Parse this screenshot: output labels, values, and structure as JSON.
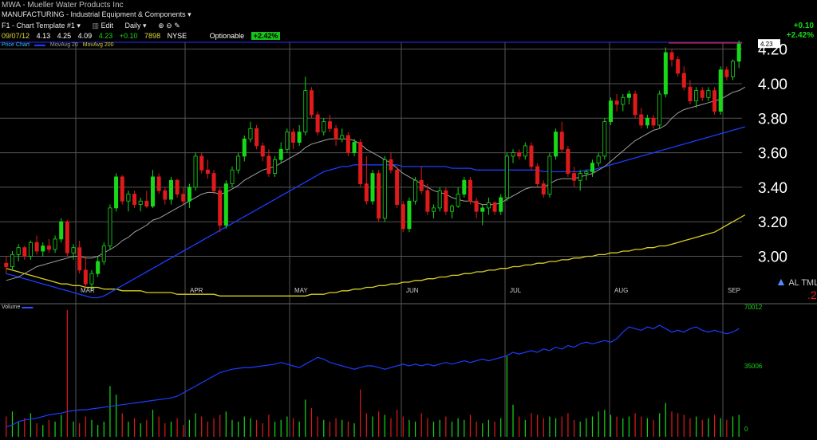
{
  "header": {
    "title": "MWA - Mueller Water Products Inc",
    "sector": "MANUFACTURING - Industrial Equipment & Components",
    "template": "F1 - Chart Template #1",
    "edit_label": "Edit",
    "period_label": "Daily",
    "date": "09/07/12",
    "open": "4.13",
    "high": "4.25",
    "low": "4.09",
    "close": "4.23",
    "change": "+0.10",
    "volume": "7898",
    "exchange": "NYSE",
    "optionable": "Optionable",
    "pct_badge": "+2.42%",
    "right_change": "+0.10",
    "right_pct": "+2.42%"
  },
  "legend": {
    "price": "Price Chart",
    "ma20": "MovAvg 20",
    "ma200": "MovAvg 200"
  },
  "tools": {
    "label": "AL TML",
    "extra": ".2"
  },
  "volume_label": "Volume",
  "colors": {
    "up": "#17d917",
    "down": "#e01a1a",
    "ma20": "#a0a0a0",
    "ma50": "#1a3dff",
    "ma200": "#d8d020",
    "grid": "#555555",
    "volume_ma": "#1a3dff"
  },
  "chart_data": {
    "type": "candlestick",
    "price_axis": {
      "ticks": [
        3.0,
        3.2,
        3.4,
        3.6,
        3.8,
        4.0,
        4.2
      ],
      "labels": [
        "3.00",
        "3.20",
        "3.40",
        "3.60",
        "3.80",
        "4.00",
        "4.20"
      ],
      "ylim": [
        2.73,
        4.24
      ]
    },
    "x_labels": [
      "MAR",
      "APR",
      "MAY",
      "JUN",
      "JUL",
      "AUG",
      "SEP"
    ],
    "last_price_label": "4.23",
    "candles": [
      [
        2.96,
        3.0,
        2.9,
        2.94
      ],
      [
        2.94,
        3.03,
        2.92,
        3.01
      ],
      [
        3.01,
        3.07,
        2.97,
        3.05
      ],
      [
        3.05,
        3.06,
        2.98,
        3.0
      ],
      [
        3.0,
        3.09,
        2.98,
        3.08
      ],
      [
        3.08,
        3.12,
        3.01,
        3.03
      ],
      [
        3.03,
        3.08,
        3.0,
        3.06
      ],
      [
        3.06,
        3.1,
        3.02,
        3.04
      ],
      [
        3.04,
        3.12,
        3.02,
        3.1
      ],
      [
        3.1,
        3.22,
        3.08,
        3.2
      ],
      [
        3.2,
        3.21,
        3.0,
        3.02
      ],
      [
        3.02,
        3.07,
        2.98,
        3.05
      ],
      [
        3.05,
        3.09,
        2.9,
        2.92
      ],
      [
        2.92,
        3.0,
        2.82,
        2.84
      ],
      [
        2.84,
        2.92,
        2.8,
        2.9
      ],
      [
        2.9,
        3.0,
        2.88,
        2.97
      ],
      [
        2.97,
        3.08,
        2.95,
        3.06
      ],
      [
        3.06,
        3.3,
        3.04,
        3.28
      ],
      [
        3.28,
        3.48,
        3.26,
        3.46
      ],
      [
        3.46,
        3.47,
        3.3,
        3.32
      ],
      [
        3.32,
        3.38,
        3.26,
        3.36
      ],
      [
        3.36,
        3.38,
        3.28,
        3.3
      ],
      [
        3.3,
        3.34,
        3.26,
        3.32
      ],
      [
        3.32,
        3.38,
        3.28,
        3.29
      ],
      [
        3.29,
        3.5,
        3.28,
        3.46
      ],
      [
        3.46,
        3.48,
        3.36,
        3.38
      ],
      [
        3.38,
        3.4,
        3.3,
        3.33
      ],
      [
        3.33,
        3.46,
        3.3,
        3.44
      ],
      [
        3.44,
        3.45,
        3.34,
        3.36
      ],
      [
        3.36,
        3.4,
        3.3,
        3.32
      ],
      [
        3.32,
        3.42,
        3.28,
        3.4
      ],
      [
        3.4,
        3.6,
        3.38,
        3.58
      ],
      [
        3.58,
        3.6,
        3.48,
        3.5
      ],
      [
        3.5,
        3.56,
        3.45,
        3.48
      ],
      [
        3.48,
        3.5,
        3.36,
        3.38
      ],
      [
        3.38,
        3.4,
        3.14,
        3.18
      ],
      [
        3.18,
        3.44,
        3.16,
        3.42
      ],
      [
        3.42,
        3.52,
        3.4,
        3.5
      ],
      [
        3.5,
        3.6,
        3.48,
        3.58
      ],
      [
        3.58,
        3.7,
        3.55,
        3.68
      ],
      [
        3.68,
        3.78,
        3.66,
        3.74
      ],
      [
        3.74,
        3.76,
        3.62,
        3.64
      ],
      [
        3.64,
        3.66,
        3.55,
        3.58
      ],
      [
        3.58,
        3.62,
        3.46,
        3.48
      ],
      [
        3.48,
        3.58,
        3.46,
        3.56
      ],
      [
        3.56,
        3.66,
        3.54,
        3.62
      ],
      [
        3.62,
        3.74,
        3.6,
        3.72
      ],
      [
        3.72,
        3.74,
        3.62,
        3.66
      ],
      [
        3.66,
        3.76,
        3.64,
        3.72
      ],
      [
        3.72,
        4.04,
        3.7,
        3.96
      ],
      [
        3.96,
        3.98,
        3.8,
        3.82
      ],
      [
        3.82,
        3.84,
        3.7,
        3.72
      ],
      [
        3.72,
        3.8,
        3.7,
        3.78
      ],
      [
        3.78,
        3.82,
        3.72,
        3.74
      ],
      [
        3.74,
        3.76,
        3.64,
        3.68
      ],
      [
        3.68,
        3.74,
        3.66,
        3.7
      ],
      [
        3.7,
        3.72,
        3.58,
        3.6
      ],
      [
        3.6,
        3.68,
        3.58,
        3.66
      ],
      [
        3.66,
        3.68,
        3.4,
        3.42
      ],
      [
        3.42,
        3.58,
        3.3,
        3.32
      ],
      [
        3.32,
        3.5,
        3.3,
        3.48
      ],
      [
        3.48,
        3.5,
        3.2,
        3.22
      ],
      [
        3.22,
        3.58,
        3.2,
        3.56
      ],
      [
        3.56,
        3.6,
        3.48,
        3.5
      ],
      [
        3.5,
        3.52,
        3.28,
        3.3
      ],
      [
        3.3,
        3.32,
        3.14,
        3.16
      ],
      [
        3.16,
        3.34,
        3.14,
        3.32
      ],
      [
        3.32,
        3.46,
        3.3,
        3.44
      ],
      [
        3.44,
        3.52,
        3.36,
        3.38
      ],
      [
        3.38,
        3.42,
        3.24,
        3.26
      ],
      [
        3.26,
        3.3,
        3.22,
        3.28
      ],
      [
        3.28,
        3.4,
        3.26,
        3.38
      ],
      [
        3.38,
        3.4,
        3.24,
        3.26
      ],
      [
        3.26,
        3.3,
        3.22,
        3.29
      ],
      [
        3.29,
        3.4,
        3.28,
        3.36
      ],
      [
        3.36,
        3.46,
        3.34,
        3.44
      ],
      [
        3.44,
        3.46,
        3.3,
        3.32
      ],
      [
        3.32,
        3.34,
        3.22,
        3.26
      ],
      [
        3.26,
        3.3,
        3.18,
        3.28
      ],
      [
        3.28,
        3.34,
        3.24,
        3.31
      ],
      [
        3.31,
        3.32,
        3.24,
        3.26
      ],
      [
        3.26,
        3.36,
        3.24,
        3.34
      ],
      [
        3.34,
        3.6,
        3.32,
        3.58
      ],
      [
        3.58,
        3.62,
        3.54,
        3.6
      ],
      [
        3.6,
        3.62,
        3.56,
        3.58
      ],
      [
        3.58,
        3.66,
        3.56,
        3.64
      ],
      [
        3.64,
        3.66,
        3.5,
        3.52
      ],
      [
        3.52,
        3.54,
        3.4,
        3.42
      ],
      [
        3.42,
        3.44,
        3.34,
        3.36
      ],
      [
        3.36,
        3.6,
        3.34,
        3.58
      ],
      [
        3.58,
        3.74,
        3.56,
        3.72
      ],
      [
        3.72,
        3.78,
        3.6,
        3.62
      ],
      [
        3.62,
        3.64,
        3.46,
        3.48
      ],
      [
        3.48,
        3.52,
        3.4,
        3.44
      ],
      [
        3.44,
        3.5,
        3.38,
        3.48
      ],
      [
        3.48,
        3.5,
        3.44,
        3.49
      ],
      [
        3.49,
        3.56,
        3.46,
        3.54
      ],
      [
        3.54,
        3.6,
        3.52,
        3.58
      ],
      [
        3.58,
        3.8,
        3.56,
        3.78
      ],
      [
        3.78,
        3.92,
        3.76,
        3.9
      ],
      [
        3.9,
        3.94,
        3.84,
        3.88
      ],
      [
        3.88,
        3.94,
        3.84,
        3.92
      ],
      [
        3.92,
        3.96,
        3.88,
        3.94
      ],
      [
        3.94,
        3.96,
        3.8,
        3.82
      ],
      [
        3.82,
        3.86,
        3.74,
        3.76
      ],
      [
        3.76,
        3.82,
        3.74,
        3.8
      ],
      [
        3.8,
        3.82,
        3.74,
        3.76
      ],
      [
        3.76,
        3.96,
        3.74,
        3.94
      ],
      [
        3.94,
        4.21,
        3.92,
        4.18
      ],
      [
        4.18,
        4.2,
        4.1,
        4.14
      ],
      [
        4.14,
        4.16,
        4.04,
        4.06
      ],
      [
        4.06,
        4.1,
        3.96,
        3.98
      ],
      [
        3.98,
        4.02,
        3.88,
        3.9
      ],
      [
        3.9,
        3.98,
        3.86,
        3.96
      ],
      [
        3.96,
        3.98,
        3.9,
        3.92
      ],
      [
        3.92,
        3.98,
        3.9,
        3.96
      ],
      [
        3.96,
        3.98,
        3.82,
        3.84
      ],
      [
        3.84,
        4.1,
        3.82,
        4.08
      ],
      [
        4.08,
        4.1,
        4.02,
        4.04
      ],
      [
        4.04,
        4.14,
        4.02,
        4.13
      ],
      [
        4.13,
        4.25,
        4.09,
        4.23
      ]
    ],
    "ma20": [
      2.86,
      2.87,
      2.88,
      2.9,
      2.92,
      2.94,
      2.95,
      2.96,
      2.97,
      2.98,
      2.99,
      3.0,
      3.0,
      2.99,
      2.99,
      3.0,
      3.02,
      3.04,
      3.06,
      3.09,
      3.11,
      3.14,
      3.16,
      3.18,
      3.21,
      3.22,
      3.24,
      3.26,
      3.28,
      3.3,
      3.32,
      3.34,
      3.36,
      3.37,
      3.37,
      3.36,
      3.37,
      3.39,
      3.41,
      3.44,
      3.46,
      3.48,
      3.5,
      3.51,
      3.52,
      3.54,
      3.56,
      3.58,
      3.6,
      3.63,
      3.65,
      3.66,
      3.67,
      3.68,
      3.68,
      3.68,
      3.68,
      3.67,
      3.65,
      3.62,
      3.6,
      3.58,
      3.56,
      3.54,
      3.51,
      3.48,
      3.46,
      3.44,
      3.42,
      3.4,
      3.38,
      3.37,
      3.36,
      3.34,
      3.33,
      3.32,
      3.32,
      3.31,
      3.3,
      3.3,
      3.3,
      3.31,
      3.33,
      3.35,
      3.37,
      3.39,
      3.4,
      3.4,
      3.4,
      3.42,
      3.44,
      3.45,
      3.45,
      3.45,
      3.46,
      3.47,
      3.48,
      3.5,
      3.52,
      3.55,
      3.58,
      3.61,
      3.64,
      3.67,
      3.69,
      3.71,
      3.73,
      3.74,
      3.76,
      3.8,
      3.83,
      3.85,
      3.86,
      3.87,
      3.88,
      3.89,
      3.9,
      3.91,
      3.93,
      3.95,
      3.96,
      3.98
    ],
    "ma50": [
      2.9,
      2.89,
      2.88,
      2.87,
      2.86,
      2.85,
      2.84,
      2.83,
      2.82,
      2.81,
      2.8,
      2.79,
      2.78,
      2.77,
      2.76,
      2.76,
      2.77,
      2.79,
      2.81,
      2.83,
      2.85,
      2.87,
      2.89,
      2.91,
      2.93,
      2.95,
      2.97,
      2.99,
      3.01,
      3.03,
      3.05,
      3.07,
      3.09,
      3.11,
      3.13,
      3.15,
      3.17,
      3.19,
      3.21,
      3.23,
      3.25,
      3.27,
      3.29,
      3.31,
      3.33,
      3.35,
      3.37,
      3.39,
      3.41,
      3.43,
      3.45,
      3.47,
      3.49,
      3.5,
      3.51,
      3.52,
      3.52,
      3.53,
      3.53,
      3.53,
      3.53,
      3.53,
      3.53,
      3.53,
      3.53,
      3.52,
      3.52,
      3.52,
      3.52,
      3.52,
      3.52,
      3.52,
      3.52,
      3.51,
      3.51,
      3.51,
      3.51,
      3.5,
      3.5,
      3.5,
      3.5,
      3.5,
      3.5,
      3.5,
      3.5,
      3.5,
      3.5,
      3.5,
      3.49,
      3.49,
      3.49,
      3.49,
      3.49,
      3.49,
      3.49,
      3.5,
      3.5,
      3.51,
      3.52,
      3.53,
      3.54,
      3.55,
      3.56,
      3.57,
      3.58,
      3.59,
      3.6,
      3.61,
      3.62,
      3.63,
      3.64,
      3.65,
      3.66,
      3.67,
      3.68,
      3.69,
      3.7,
      3.71,
      3.72,
      3.73,
      3.74,
      3.75
    ],
    "ma200": [
      2.93,
      2.92,
      2.91,
      2.9,
      2.89,
      2.88,
      2.87,
      2.86,
      2.85,
      2.84,
      2.84,
      2.83,
      2.83,
      2.82,
      2.82,
      2.82,
      2.81,
      2.81,
      2.81,
      2.8,
      2.8,
      2.8,
      2.8,
      2.79,
      2.79,
      2.79,
      2.79,
      2.79,
      2.78,
      2.78,
      2.78,
      2.78,
      2.78,
      2.78,
      2.78,
      2.77,
      2.77,
      2.77,
      2.77,
      2.77,
      2.77,
      2.77,
      2.77,
      2.77,
      2.77,
      2.77,
      2.77,
      2.77,
      2.77,
      2.77,
      2.78,
      2.78,
      2.78,
      2.79,
      2.79,
      2.8,
      2.8,
      2.81,
      2.81,
      2.82,
      2.82,
      2.83,
      2.83,
      2.84,
      2.84,
      2.85,
      2.85,
      2.86,
      2.86,
      2.87,
      2.87,
      2.88,
      2.88,
      2.89,
      2.89,
      2.9,
      2.9,
      2.91,
      2.91,
      2.92,
      2.92,
      2.93,
      2.93,
      2.94,
      2.94,
      2.95,
      2.95,
      2.96,
      2.96,
      2.97,
      2.97,
      2.98,
      2.98,
      2.99,
      2.99,
      3.0,
      3.0,
      3.01,
      3.01,
      3.02,
      3.02,
      3.03,
      3.03,
      3.04,
      3.04,
      3.05,
      3.05,
      3.06,
      3.06,
      3.07,
      3.08,
      3.09,
      3.1,
      3.11,
      3.12,
      3.13,
      3.14,
      3.16,
      3.18,
      3.2,
      3.22,
      3.24
    ],
    "volume_axis": {
      "labels": [
        "70012",
        "35006",
        "0"
      ],
      "ylim": [
        0,
        75000
      ]
    },
    "volume": [
      12000,
      15000,
      9000,
      11000,
      14000,
      8000,
      7000,
      10000,
      9000,
      13000,
      75000,
      9000,
      8000,
      12000,
      10000,
      7000,
      9000,
      30000,
      25000,
      14000,
      9000,
      11000,
      8000,
      10000,
      16000,
      12000,
      8000,
      9000,
      11000,
      7000,
      10000,
      14000,
      12000,
      9000,
      11000,
      13000,
      15000,
      10000,
      9000,
      12000,
      11000,
      10000,
      8000,
      13000,
      9000,
      10000,
      12000,
      11000,
      9000,
      22000,
      17000,
      12000,
      10000,
      9000,
      11000,
      10000,
      9000,
      8000,
      28000,
      14000,
      12000,
      15000,
      13000,
      11000,
      16000,
      12000,
      10000,
      9000,
      14000,
      11000,
      9000,
      10000,
      12000,
      9000,
      11000,
      10000,
      13000,
      9000,
      8000,
      10000,
      9000,
      11000,
      48000,
      19000,
      12000,
      10000,
      14000,
      13000,
      11000,
      12000,
      11000,
      12000,
      14000,
      10000,
      9000,
      11000,
      12000,
      15000,
      16000,
      13000,
      12000,
      11000,
      12000,
      14000,
      12000,
      11000,
      10000,
      14000,
      20000,
      15000,
      14000,
      13000,
      11000,
      12000,
      10000,
      11000,
      13000,
      11000,
      10000,
      12000,
      13000
    ],
    "volume_ma": [
      6000,
      7000,
      9000,
      10000,
      10500,
      11000,
      12000,
      13000,
      13500,
      14000,
      15000,
      15500,
      16000,
      16000,
      16500,
      17000,
      17500,
      18000,
      18500,
      19000,
      19500,
      20000,
      20500,
      21000,
      21500,
      22000,
      22500,
      23000,
      24000,
      26000,
      28000,
      30000,
      32000,
      34000,
      36000,
      38000,
      39000,
      40000,
      40500,
      41000,
      41000,
      41500,
      42000,
      42500,
      43000,
      44000,
      43000,
      42000,
      41000,
      43000,
      45000,
      47000,
      46000,
      44000,
      43000,
      42000,
      41000,
      40000,
      41000,
      42000,
      42000,
      41000,
      40000,
      41000,
      42000,
      43000,
      42000,
      43000,
      42000,
      43000,
      42000,
      43000,
      44000,
      43000,
      44000,
      45000,
      44000,
      45000,
      46000,
      45000,
      46000,
      47000,
      48000,
      50000,
      49000,
      50000,
      51000,
      50000,
      52000,
      51000,
      53000,
      52000,
      54000,
      53000,
      55000,
      56000,
      55000,
      56000,
      57000,
      56000,
      58000,
      62000,
      65000,
      64000,
      63000,
      65000,
      64000,
      66000,
      64000,
      62000,
      63000,
      62000,
      64000,
      65000,
      63000,
      62000,
      63000,
      62000,
      61000,
      62000,
      64000
    ]
  }
}
